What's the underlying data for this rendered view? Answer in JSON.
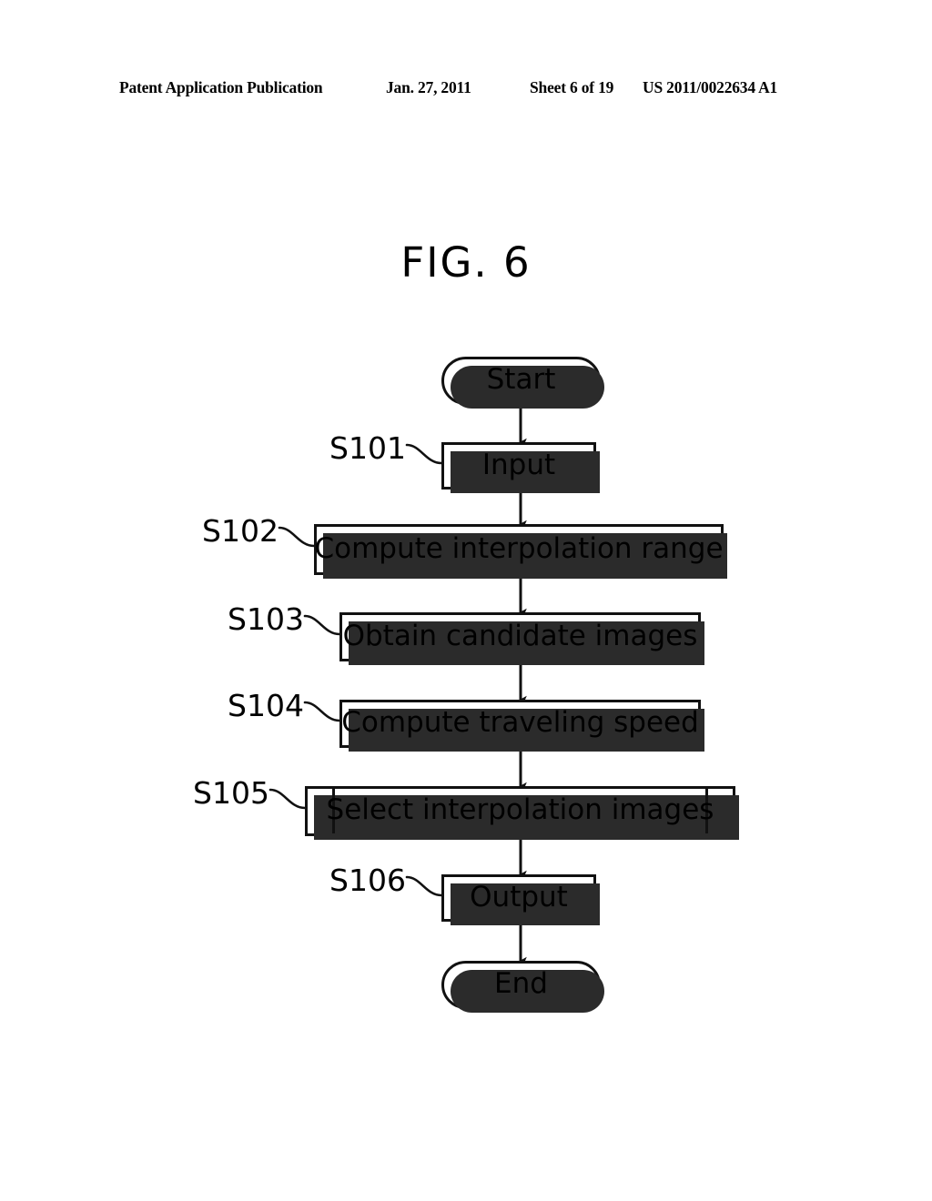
{
  "header": {
    "publication": "Patent Application Publication",
    "date": "Jan. 27, 2011",
    "sheet": "Sheet 6 of 19",
    "patent_number": "US 2011/0022634 A1"
  },
  "figure": {
    "title": "FIG. 6"
  },
  "flowchart": {
    "nodes": [
      {
        "id": "start",
        "label": "Start",
        "shape": "terminator",
        "step": ""
      },
      {
        "id": "s101",
        "label": "Input",
        "shape": "process",
        "step": "S101"
      },
      {
        "id": "s102",
        "label": "Compute interpolation range",
        "shape": "process",
        "step": "S102"
      },
      {
        "id": "s103",
        "label": "Obtain candidate images",
        "shape": "process",
        "step": "S103"
      },
      {
        "id": "s104",
        "label": "Compute traveling speed",
        "shape": "process",
        "step": "S104"
      },
      {
        "id": "s105",
        "label": "Select interpolation images",
        "shape": "predefined-process",
        "step": "S105"
      },
      {
        "id": "s106",
        "label": "Output",
        "shape": "process",
        "step": "S106"
      },
      {
        "id": "end",
        "label": "End",
        "shape": "terminator",
        "step": ""
      }
    ],
    "edges": [
      {
        "from": "start",
        "to": "s101"
      },
      {
        "from": "s101",
        "to": "s102"
      },
      {
        "from": "s102",
        "to": "s103"
      },
      {
        "from": "s103",
        "to": "s104"
      },
      {
        "from": "s104",
        "to": "s105"
      },
      {
        "from": "s105",
        "to": "s106"
      },
      {
        "from": "s106",
        "to": "end"
      }
    ],
    "colors": {
      "stroke": "#111111",
      "shadow": "#2b2b2b",
      "fill": "#ffffff"
    }
  }
}
